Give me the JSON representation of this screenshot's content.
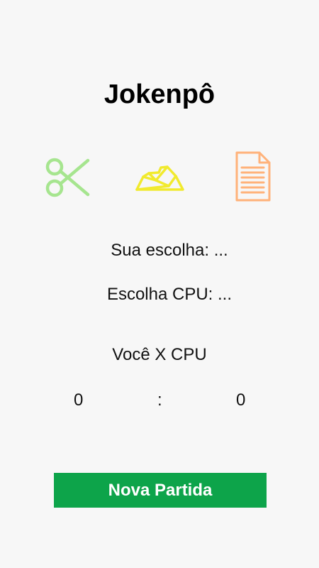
{
  "title": "Jokenpô",
  "choices": [
    {
      "name": "scissors-icon",
      "color": "#a6e58f"
    },
    {
      "name": "rock-icon",
      "color": "#f1ea2e"
    },
    {
      "name": "paper-icon",
      "color": "#ffb27a"
    }
  ],
  "your_choice": {
    "label": "Sua escolha:",
    "value": "..."
  },
  "cpu_choice": {
    "label": "Escolha CPU:",
    "value": "..."
  },
  "versus_label": "Você X CPU",
  "score": {
    "player": "0",
    "separator": ":",
    "cpu": "0"
  },
  "new_game_button": "Nova Partida",
  "colors": {
    "background": "#f7f7f7",
    "button": "#0da44a",
    "button_text": "#ffffff"
  }
}
